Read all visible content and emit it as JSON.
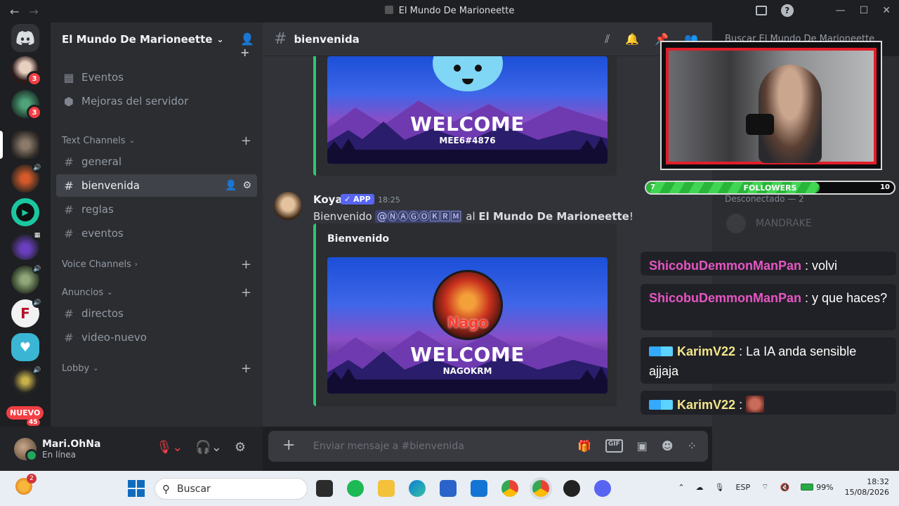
{
  "window": {
    "title": "El Mundo De Marioneette"
  },
  "server": {
    "name": "El Mundo De Marioneette"
  },
  "rail": {
    "badges": [
      "3",
      "3"
    ],
    "nuevo": "NUEVO",
    "nuevo_count": "45"
  },
  "sidebar": {
    "top_items": [
      {
        "label": "Eventos"
      },
      {
        "label": "Mejoras del servidor"
      }
    ],
    "categories": {
      "text": "Text Channels",
      "voice": "Voice Channels",
      "anuncios": "Anuncios",
      "lobby": "Lobby"
    },
    "text_channels": [
      "general",
      "bienvenida",
      "reglas",
      "eventos"
    ],
    "anuncios_channels": [
      "directos",
      "video-nuevo"
    ]
  },
  "user": {
    "name": "Mari.OhNa",
    "status": "En línea"
  },
  "channel": {
    "name": "bienvenida"
  },
  "header": {
    "search_placeholder": "Buscar El Mundo De Marioneette"
  },
  "embed1": {
    "welcome": "WELCOME",
    "user": "MEE6#4876"
  },
  "message": {
    "author": "Koya",
    "tag": "APP",
    "time": "18:25",
    "prefix": "Bienvenido",
    "mention": "@ⓃⒶⒼⓄ🄺🅁🄼",
    "mid": "al",
    "server_bold": "El Mundo De Marioneette",
    "suffix": "!"
  },
  "embed2": {
    "title": "Bienvenido",
    "welcome": "WELCOME",
    "user": "NAGOKRM",
    "logo_text": "Nago"
  },
  "composer": {
    "placeholder": "Enviar mensaje a #bienvenida"
  },
  "overlay": {
    "followers_label": "FOLLOWERS",
    "followers_current": "7",
    "followers_goal": "10",
    "followers_progress": 0.7,
    "offline_header": "Desconectado — 2",
    "member": "MANDRAKE",
    "chat": [
      {
        "user": "ShicobuDemmonManPan",
        "text": "volvi",
        "color": "#e655c4"
      },
      {
        "user": "ShicobuDemmonManPan",
        "text": "y que haces?",
        "color": "#e655c4"
      },
      {
        "user": "KarimV22",
        "text": "La IA anda sensible ajjaja",
        "color": "#f3e58a"
      },
      {
        "user": "KarimV22",
        "text": "",
        "color": "#f3e58a"
      }
    ]
  },
  "taskbar": {
    "search": "Buscar",
    "weather_badge": "2",
    "lang": "ESP",
    "battery": "99%",
    "time": "18:32",
    "date": "15/08/2026"
  }
}
